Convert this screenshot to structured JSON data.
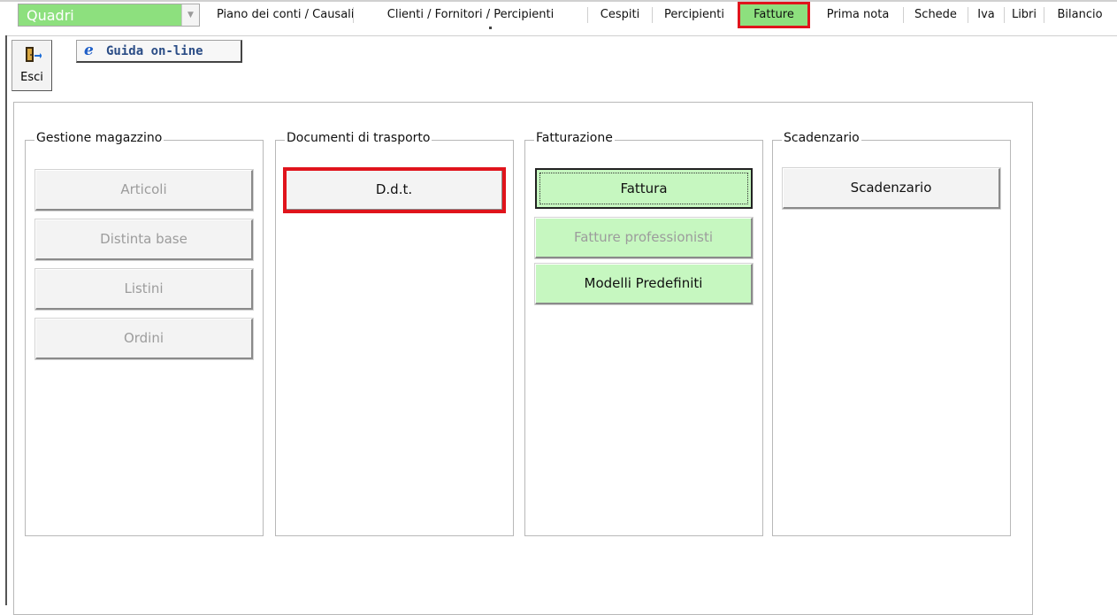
{
  "menubar": {
    "module_select": "Quadri",
    "tabs": [
      "Piano dei conti / Causali",
      "Clienti / Fornitori / Percipienti",
      "Cespiti",
      "Percipienti",
      "Fatture",
      "Prima nota",
      "Schede",
      "Iva",
      "Libri",
      "Bilancio"
    ],
    "active_tab": "Fatture"
  },
  "toolbar": {
    "exit_label": "Esci",
    "exit_icon": "exit-door-icon",
    "help_label": "Guida on-line",
    "help_icon": "internet-explorer-icon"
  },
  "groups": [
    {
      "title": "Gestione magazzino",
      "buttons": [
        "Articoli",
        "Distinta base",
        "Listini",
        "Ordini"
      ]
    },
    {
      "title": "Documenti di trasporto",
      "buttons": [
        "D.d.t."
      ]
    },
    {
      "title": "Fatturazione",
      "buttons": [
        "Fattura",
        "Fatture professionisti",
        "Modelli Predefiniti"
      ]
    },
    {
      "title": "Scadenzario",
      "buttons": [
        "Scadenzario"
      ]
    }
  ],
  "colors": {
    "accent_green": "#8de07e",
    "button_green": "#c6f7c0",
    "highlight_red": "#e0141c"
  }
}
